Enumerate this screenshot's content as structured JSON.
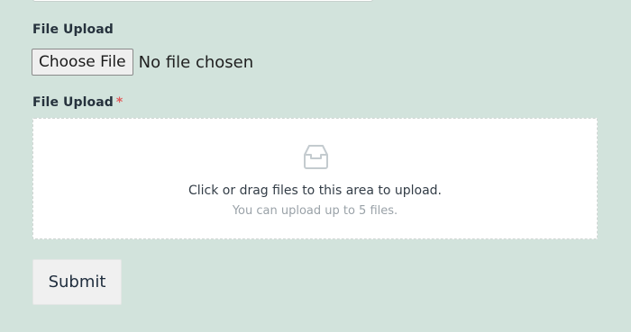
{
  "form": {
    "upload_field_1": {
      "label": "File Upload",
      "button_label": "Choose File",
      "status": "No file chosen"
    },
    "upload_field_2": {
      "label": "File Upload",
      "required_mark": "*",
      "dropzone_title": "Click or drag files to this area to upload.",
      "dropzone_hint": "You can upload up to 5 files.",
      "icon": "inbox-icon"
    },
    "submit_label": "Submit"
  },
  "colors": {
    "background": "#d2e3dc",
    "required": "#e25b5b",
    "dropzone_bg": "#ffffff",
    "dropzone_border": "#cfd6d3"
  }
}
